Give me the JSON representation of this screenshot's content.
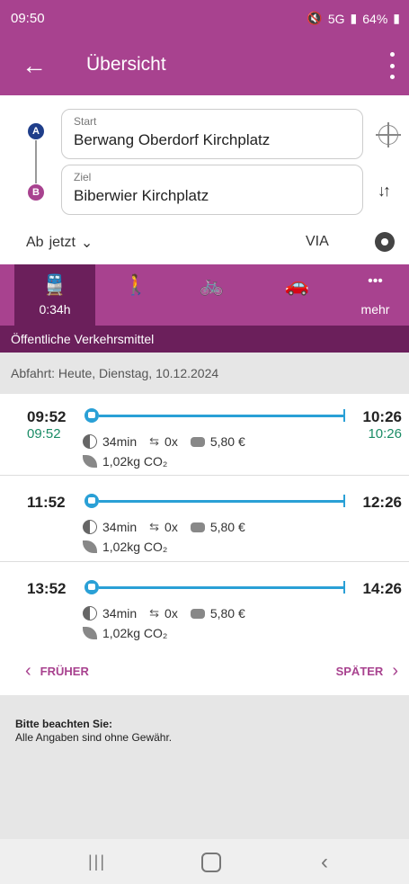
{
  "status": {
    "time": "09:50",
    "battery": "64%",
    "signal": "5G"
  },
  "header": {
    "title": "Übersicht"
  },
  "form": {
    "start_label": "Start",
    "start_value": "Berwang Oberdorf Kirchplatz",
    "ziel_label": "Ziel",
    "ziel_value": "Biberwier Kirchplatz",
    "pin_a": "A",
    "pin_b": "B",
    "ab_label": "Ab",
    "ab_value": "jetzt",
    "via": "VIA"
  },
  "modes": [
    {
      "name": "public-transport",
      "icon": "🚆",
      "sub": "0:34h"
    },
    {
      "name": "walk",
      "icon": "🚶",
      "sub": ""
    },
    {
      "name": "bike",
      "icon": "🚲",
      "sub": ""
    },
    {
      "name": "car",
      "icon": "🚗",
      "sub": ""
    },
    {
      "name": "more",
      "icon": "•••",
      "sub": "mehr"
    }
  ],
  "mode_label": "Öffentliche Verkehrsmittel",
  "departure": "Abfahrt: Heute, Dienstag, 10.12.2024",
  "connections": [
    {
      "dep": "09:52",
      "dep_rt": "09:52",
      "arr": "10:26",
      "arr_rt": "10:26",
      "duration": "34min",
      "changes": "0x",
      "price": "5,80 €",
      "co2": "1,02kg CO₂"
    },
    {
      "dep": "11:52",
      "dep_rt": "",
      "arr": "12:26",
      "arr_rt": "",
      "duration": "34min",
      "changes": "0x",
      "price": "5,80 €",
      "co2": "1,02kg CO₂"
    },
    {
      "dep": "13:52",
      "dep_rt": "",
      "arr": "14:26",
      "arr_rt": "",
      "duration": "34min",
      "changes": "0x",
      "price": "5,80 €",
      "co2": "1,02kg CO₂"
    }
  ],
  "pager": {
    "earlier": "FRÜHER",
    "later": "SPÄTER"
  },
  "notice": {
    "heading": "Bitte beachten Sie:",
    "text": "Alle Angaben sind ohne Gewähr."
  }
}
